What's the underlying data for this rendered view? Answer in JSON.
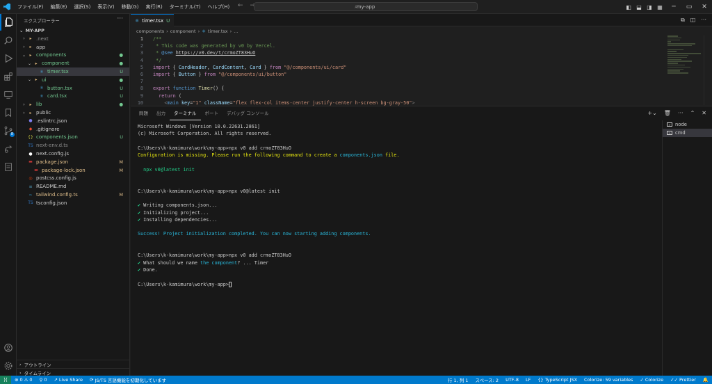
{
  "menu": [
    "ファイル(F)",
    "編集(E)",
    "選択(S)",
    "表示(V)",
    "移動(G)",
    "実行(R)",
    "ターミナル(T)",
    "ヘルプ(H)"
  ],
  "search": {
    "text": "my-app"
  },
  "sidebar": {
    "title": "エクスプローラー",
    "project": "MY-APP",
    "items": [
      {
        "label": ".next",
        "chev": "›",
        "icon": "folder-icon",
        "color": "#8a8a8a",
        "status": "",
        "statusColor": "#73c991",
        "indent": 0
      },
      {
        "label": "app",
        "chev": "›",
        "icon": "folder-icon",
        "color": "#cccccc",
        "status": "",
        "statusColor": "#73c991",
        "indent": 0
      },
      {
        "label": "components",
        "chev": "⌄",
        "icon": "folder-icon",
        "color": "#73c991",
        "status": "●",
        "statusColor": "#73c991",
        "indent": 0
      },
      {
        "label": "component",
        "chev": "⌄",
        "icon": "folder-icon",
        "color": "#73c991",
        "status": "●",
        "statusColor": "#73c991",
        "indent": 1
      },
      {
        "label": "timer.tsx",
        "chev": "",
        "icon": "tsx-icon",
        "color": "#73c991",
        "status": "U",
        "statusColor": "#73c991",
        "indent": 2
      },
      {
        "label": "ui",
        "chev": "⌄",
        "icon": "folder-icon",
        "color": "#73c991",
        "status": "●",
        "statusColor": "#73c991",
        "indent": 1
      },
      {
        "label": "button.tsx",
        "chev": "",
        "icon": "tsx-icon",
        "color": "#73c991",
        "status": "U",
        "statusColor": "#73c991",
        "indent": 2
      },
      {
        "label": "card.tsx",
        "chev": "",
        "icon": "tsx-icon",
        "color": "#73c991",
        "status": "U",
        "statusColor": "#73c991",
        "indent": 2
      },
      {
        "label": "lib",
        "chev": "›",
        "icon": "folder-icon",
        "color": "#73c991",
        "status": "●",
        "statusColor": "#73c991",
        "indent": 0
      },
      {
        "label": "public",
        "chev": "›",
        "icon": "folder-icon",
        "color": "#cccccc",
        "status": "",
        "statusColor": "#73c991",
        "indent": 0
      },
      {
        "label": ".eslintrc.json",
        "chev": "",
        "icon": "eslint-icon",
        "color": "#cccccc",
        "status": "",
        "statusColor": "#73c991",
        "indent": 0
      },
      {
        "label": ".gitignore",
        "chev": "",
        "icon": "git-icon",
        "color": "#cccccc",
        "status": "",
        "statusColor": "#73c991",
        "indent": 0
      },
      {
        "label": "components.json",
        "chev": "",
        "icon": "json-icon",
        "color": "#73c991",
        "status": "U",
        "statusColor": "#73c991",
        "indent": 0
      },
      {
        "label": "next-env.d.ts",
        "chev": "",
        "icon": "ts-icon",
        "color": "#8a8a8a",
        "status": "",
        "statusColor": "#73c991",
        "indent": 0
      },
      {
        "label": "next.config.js",
        "chev": "",
        "icon": "next-icon",
        "color": "#cccccc",
        "status": "",
        "statusColor": "#73c991",
        "indent": 0
      },
      {
        "label": "package.json",
        "chev": "",
        "icon": "npm-icon",
        "color": "#e2c08d",
        "status": "M",
        "statusColor": "#e2c08d",
        "indent": 0
      },
      {
        "label": "package-lock.json",
        "chev": "",
        "icon": "npm-icon",
        "color": "#e2c08d",
        "status": "M",
        "statusColor": "#e2c08d",
        "indent": 1
      },
      {
        "label": "postcss.config.js",
        "chev": "",
        "icon": "postcss-icon",
        "color": "#cccccc",
        "status": "",
        "statusColor": "#73c991",
        "indent": 0
      },
      {
        "label": "README.md",
        "chev": "",
        "icon": "markdown-icon",
        "color": "#cccccc",
        "status": "",
        "statusColor": "#73c991",
        "indent": 0
      },
      {
        "label": "tailwind.config.ts",
        "chev": "",
        "icon": "tailwind-icon",
        "color": "#e2c08d",
        "status": "M",
        "statusColor": "#e2c08d",
        "indent": 0
      },
      {
        "label": "tsconfig.json",
        "chev": "",
        "icon": "tsconfig-icon",
        "color": "#cccccc",
        "status": "",
        "statusColor": "#73c991",
        "indent": 0
      }
    ],
    "outline": "アウトライン",
    "timeline": "タイムライン"
  },
  "editor": {
    "tab": {
      "label": "timer.tsx",
      "status": "U"
    },
    "breadcrumb": [
      "components",
      "component",
      "timer.tsx",
      "..."
    ],
    "lines": [
      [
        {
          "t": "/**",
          "c": "#6a9955"
        }
      ],
      [
        {
          "t": " * This code was generated by v0 by Vercel.",
          "c": "#6a9955"
        }
      ],
      [
        {
          "t": " * ",
          "c": "#6a9955"
        },
        {
          "t": "@see",
          "c": "#569cd6"
        },
        {
          "t": " ",
          "c": "#6a9955"
        },
        {
          "t": "https://v0.dev/t/crmoZT83HuO",
          "c": "#cccccc",
          "u": true
        }
      ],
      [
        {
          "t": " */",
          "c": "#6a9955"
        }
      ],
      [
        {
          "t": "import",
          "c": "#c586c0"
        },
        {
          "t": " { ",
          "c": "#cccccc"
        },
        {
          "t": "CardHeader",
          "c": "#9cdcfe"
        },
        {
          "t": ", ",
          "c": "#cccccc"
        },
        {
          "t": "CardContent",
          "c": "#9cdcfe"
        },
        {
          "t": ", ",
          "c": "#cccccc"
        },
        {
          "t": "Card",
          "c": "#9cdcfe"
        },
        {
          "t": " } ",
          "c": "#cccccc"
        },
        {
          "t": "from",
          "c": "#c586c0"
        },
        {
          "t": " ",
          "c": "#cccccc"
        },
        {
          "t": "\"@/components/ui/card\"",
          "c": "#ce9178"
        }
      ],
      [
        {
          "t": "import",
          "c": "#c586c0"
        },
        {
          "t": " { ",
          "c": "#cccccc"
        },
        {
          "t": "Button",
          "c": "#9cdcfe"
        },
        {
          "t": " } ",
          "c": "#cccccc"
        },
        {
          "t": "from",
          "c": "#c586c0"
        },
        {
          "t": " ",
          "c": "#cccccc"
        },
        {
          "t": "\"@/components/ui/button\"",
          "c": "#ce9178"
        }
      ],
      [
        {
          "t": "",
          "c": "#cccccc"
        }
      ],
      [
        {
          "t": "export",
          "c": "#c586c0"
        },
        {
          "t": " ",
          "c": "#cccccc"
        },
        {
          "t": "function",
          "c": "#569cd6"
        },
        {
          "t": " ",
          "c": "#cccccc"
        },
        {
          "t": "Timer",
          "c": "#dcdcaa"
        },
        {
          "t": "() {",
          "c": "#cccccc"
        }
      ],
      [
        {
          "t": "  ",
          "c": "#cccccc"
        },
        {
          "t": "return",
          "c": "#c586c0"
        },
        {
          "t": " (",
          "c": "#cccccc"
        }
      ],
      [
        {
          "t": "    <",
          "c": "#808080"
        },
        {
          "t": "main",
          "c": "#569cd6"
        },
        {
          "t": " ",
          "c": "#cccccc"
        },
        {
          "t": "key",
          "c": "#9cdcfe"
        },
        {
          "t": "=",
          "c": "#cccccc"
        },
        {
          "t": "\"1\"",
          "c": "#ce9178"
        },
        {
          "t": " ",
          "c": "#cccccc"
        },
        {
          "t": "className",
          "c": "#9cdcfe"
        },
        {
          "t": "=",
          "c": "#cccccc"
        },
        {
          "t": "\"flex flex-col items-center justify-center h-screen bg-gray-50\"",
          "c": "#ce9178"
        },
        {
          "t": ">",
          "c": "#808080"
        }
      ]
    ]
  },
  "panel": {
    "tabs": [
      "問題",
      "出力",
      "ターミナル",
      "ポート",
      "デバッグ コンソール"
    ],
    "active": 2,
    "terminal": [
      [
        {
          "t": "Microsoft Windows [Version 10.0.22631.2861]"
        }
      ],
      [
        {
          "t": "(c) Microsoft Corporation. All rights reserved."
        }
      ],
      [
        {
          "t": ""
        }
      ],
      [
        {
          "t": "C:\\Users\\k-kamimura\\work\\my-app>npx v0 add crmoZT83HuO"
        }
      ],
      [
        {
          "t": "Configuration is missing. Please run the following command to create a ",
          "c": "c-yellow"
        },
        {
          "t": "components.json",
          "c": "c-cyan"
        },
        {
          "t": " file.",
          "c": "c-yellow"
        }
      ],
      [
        {
          "t": ""
        }
      ],
      [
        {
          "t": "  npx v0@latest init",
          "c": "c-green"
        }
      ],
      [
        {
          "t": ""
        }
      ],
      [
        {
          "t": ""
        }
      ],
      [
        {
          "t": "C:\\Users\\k-kamimura\\work\\my-app>npx v0@latest init"
        }
      ],
      [
        {
          "t": ""
        }
      ],
      [
        {
          "t": "✔",
          "c": "c-ok"
        },
        {
          "t": " Writing components.json..."
        }
      ],
      [
        {
          "t": "✔",
          "c": "c-ok"
        },
        {
          "t": " Initializing project..."
        }
      ],
      [
        {
          "t": "✔",
          "c": "c-ok"
        },
        {
          "t": " Installing dependencies..."
        }
      ],
      [
        {
          "t": ""
        }
      ],
      [
        {
          "t": "Success! Project initialization completed. You can now starting adding components.",
          "c": "c-cyan"
        }
      ],
      [
        {
          "t": ""
        }
      ],
      [
        {
          "t": ""
        }
      ],
      [
        {
          "t": "C:\\Users\\k-kamimura\\work\\my-app>npx v0 add crmoZT83HuO"
        }
      ],
      [
        {
          "t": "✔",
          "c": "c-ok"
        },
        {
          "t": " What should we name "
        },
        {
          "t": "the component",
          "c": "c-cyan"
        },
        {
          "t": "? ... Timer"
        }
      ],
      [
        {
          "t": "✔",
          "c": "c-ok"
        },
        {
          "t": " Done."
        }
      ],
      [
        {
          "t": ""
        }
      ],
      [
        {
          "t": "C:\\Users\\k-kamimura\\work\\my-app>"
        },
        {
          "cursor": true
        }
      ]
    ],
    "terminal_list": [
      "node",
      "cmd"
    ]
  },
  "status": {
    "errors": "0",
    "warnings": "0",
    "ports": "0",
    "liveshare": "Live Share",
    "jsts": "JS/TS 言語機能を初期化しています",
    "position": "行 1, 列 1",
    "spaces": "スペース: 2",
    "encoding": "UTF-8",
    "eol": "LF",
    "language": "TypeScript JSX",
    "colorize": "Colorize: 59 variables",
    "colorize2": "Colorize",
    "prettier": "Prettier"
  }
}
